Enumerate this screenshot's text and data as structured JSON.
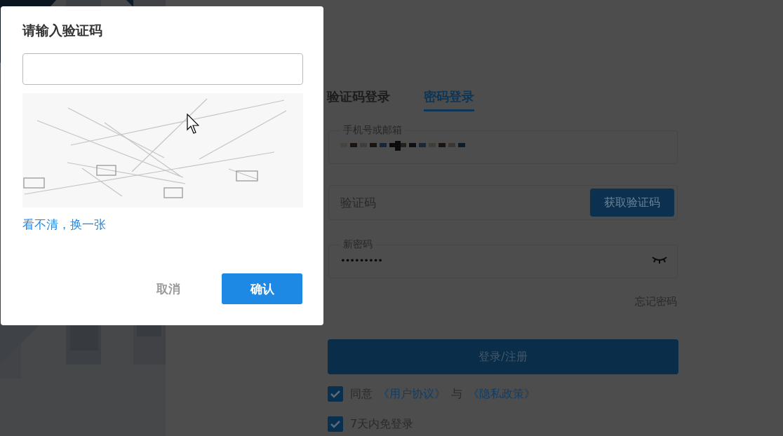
{
  "login": {
    "tabs": [
      {
        "label": "验证码登录",
        "selected": false
      },
      {
        "label": "密码登录",
        "selected": true
      }
    ],
    "account_field": {
      "label": "手机号或邮箱",
      "value_redacted": true
    },
    "code_field": {
      "placeholder": "验证码",
      "button": "获取验证码"
    },
    "password_field": {
      "label": "新密码",
      "value": "•••••••••"
    },
    "forgot_link": "忘记密码",
    "submit_button": "登录/注册",
    "agreement": {
      "checked": true,
      "parts": [
        {
          "kind": "text",
          "text": "同意"
        },
        {
          "kind": "link",
          "text": "《用户协议》"
        },
        {
          "kind": "text",
          "text": "与"
        },
        {
          "kind": "link",
          "text": "《隐私政策》"
        }
      ]
    },
    "remember": {
      "checked": true,
      "label": "7天内免登录"
    }
  },
  "dialog": {
    "title": "请输入验证码",
    "refresh_link": "看不清，换一张",
    "cancel_button": "取消",
    "confirm_button": "确认"
  }
}
